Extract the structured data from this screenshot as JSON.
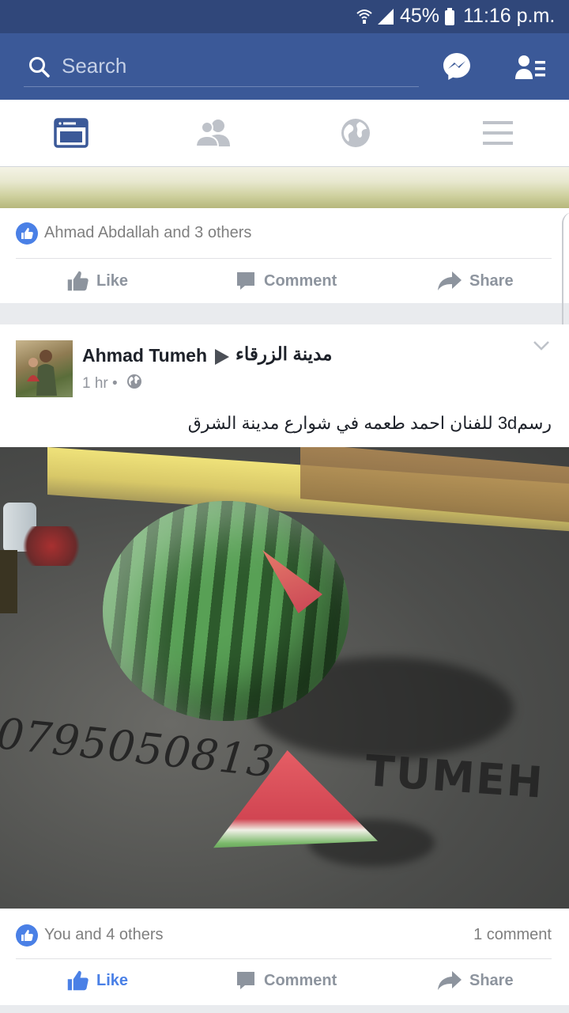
{
  "status_bar": {
    "battery": "45%",
    "time": "11:16 p.m."
  },
  "search": {
    "placeholder": "Search"
  },
  "tabs": [
    {
      "name": "news-feed",
      "active": true
    },
    {
      "name": "friends",
      "active": false
    },
    {
      "name": "notifications",
      "active": false
    },
    {
      "name": "menu",
      "active": false
    }
  ],
  "post1": {
    "reactions_text": "Ahmad Abdallah and 3 others",
    "actions": {
      "like": "Like",
      "comment": "Comment",
      "share": "Share"
    }
  },
  "post2": {
    "author": "Ahmad Tumeh",
    "group": "مدينة الزرقاء",
    "time": "1 hr",
    "privacy_dot": "•",
    "text": "رسم3d للفنان احمد طعمه في شوارع مدينة الشرق",
    "image_text": {
      "phone": "0795050813",
      "signature": "TUMEH"
    },
    "reactions_text": "You and 4 others",
    "comments_count": "1 comment",
    "actions": {
      "like": "Like",
      "comment": "Comment",
      "share": "Share"
    }
  },
  "colors": {
    "brand": "#3b5998",
    "status_bar": "#30477a",
    "liked_blue": "#4a80e6",
    "muted_gray": "#8d949e"
  }
}
